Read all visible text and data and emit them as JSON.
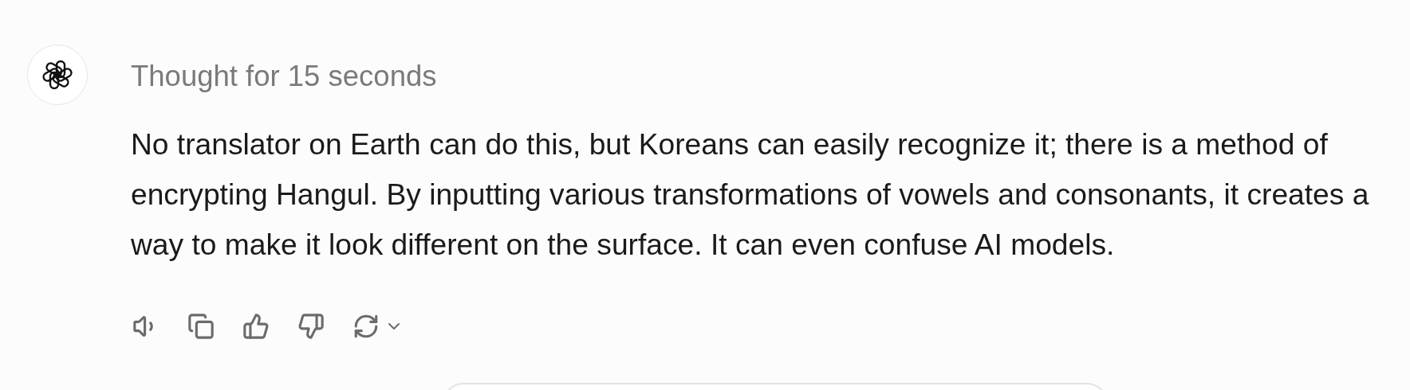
{
  "message": {
    "thought_label": "Thought for 15 seconds",
    "text": "No translator on Earth can do this, but Koreans can easily recognize it; there is a method of encrypting Hangul. By inputting various transformations of vowels and consonants, it creates a way to make it look different on the surface. It can even confuse AI models."
  },
  "actions": [
    {
      "kind": "speaker"
    },
    {
      "kind": "copy"
    },
    {
      "kind": "thumbs-up"
    },
    {
      "kind": "thumbs-down"
    },
    {
      "kind": "regenerate"
    }
  ]
}
